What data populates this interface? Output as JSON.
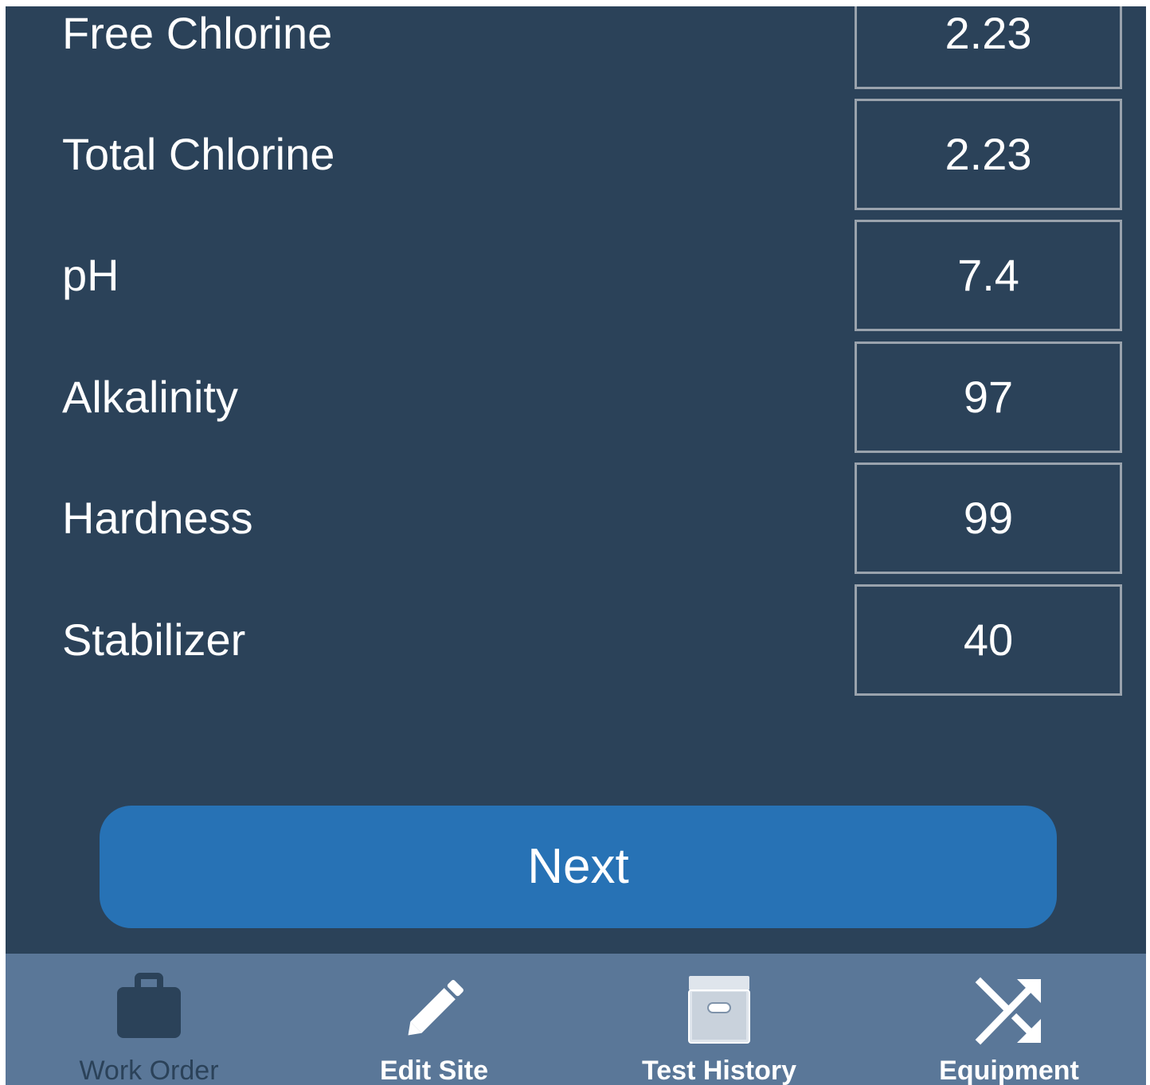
{
  "readings": [
    {
      "label": "Free Chlorine",
      "value": "2.23"
    },
    {
      "label": "Total Chlorine",
      "value": "2.23"
    },
    {
      "label": "pH",
      "value": "7.4"
    },
    {
      "label": "Alkalinity",
      "value": "97"
    },
    {
      "label": "Hardness",
      "value": "99"
    },
    {
      "label": "Stabilizer",
      "value": "40"
    }
  ],
  "next_button": {
    "label": "Next"
  },
  "tabbar": {
    "tabs": [
      {
        "label": "Work Order",
        "icon": "briefcase-icon",
        "active": true
      },
      {
        "label": "Edit Site",
        "icon": "pencil-icon",
        "active": false
      },
      {
        "label": "Test History",
        "icon": "archive-box-icon",
        "active": false
      },
      {
        "label": "Equipment",
        "icon": "shuffle-icon",
        "active": false
      }
    ]
  },
  "colors": {
    "background": "#2b4259",
    "button": "#2772b5",
    "tabbar": "#5a7798",
    "active_tab": "#2b4259"
  }
}
